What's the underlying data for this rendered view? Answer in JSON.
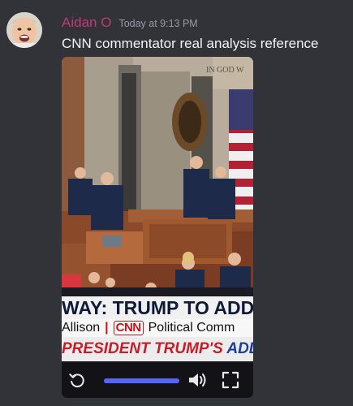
{
  "message": {
    "username": "Aidan O",
    "timestamp": "Today at 9:13 PM",
    "content": "CNN commentator real analysis reference",
    "username_color": "#c03a72"
  },
  "video": {
    "caption_top": "WAY: TRUMP TO ADDRES",
    "caption_mid_name": "Allison",
    "caption_mid_sep": "|",
    "caption_mid_logo": "CNN",
    "caption_mid_title": "Political Comm",
    "caption_bottom_red": "PRESIDENT TRUMP'S ",
    "caption_bottom_blue": "ADDRESS TO",
    "scene_text": "IN GOD W",
    "progress_fraction": 1.0,
    "accent_color": "#5865f2",
    "icons": [
      "replay-icon",
      "volume-icon",
      "fullscreen-icon"
    ]
  }
}
